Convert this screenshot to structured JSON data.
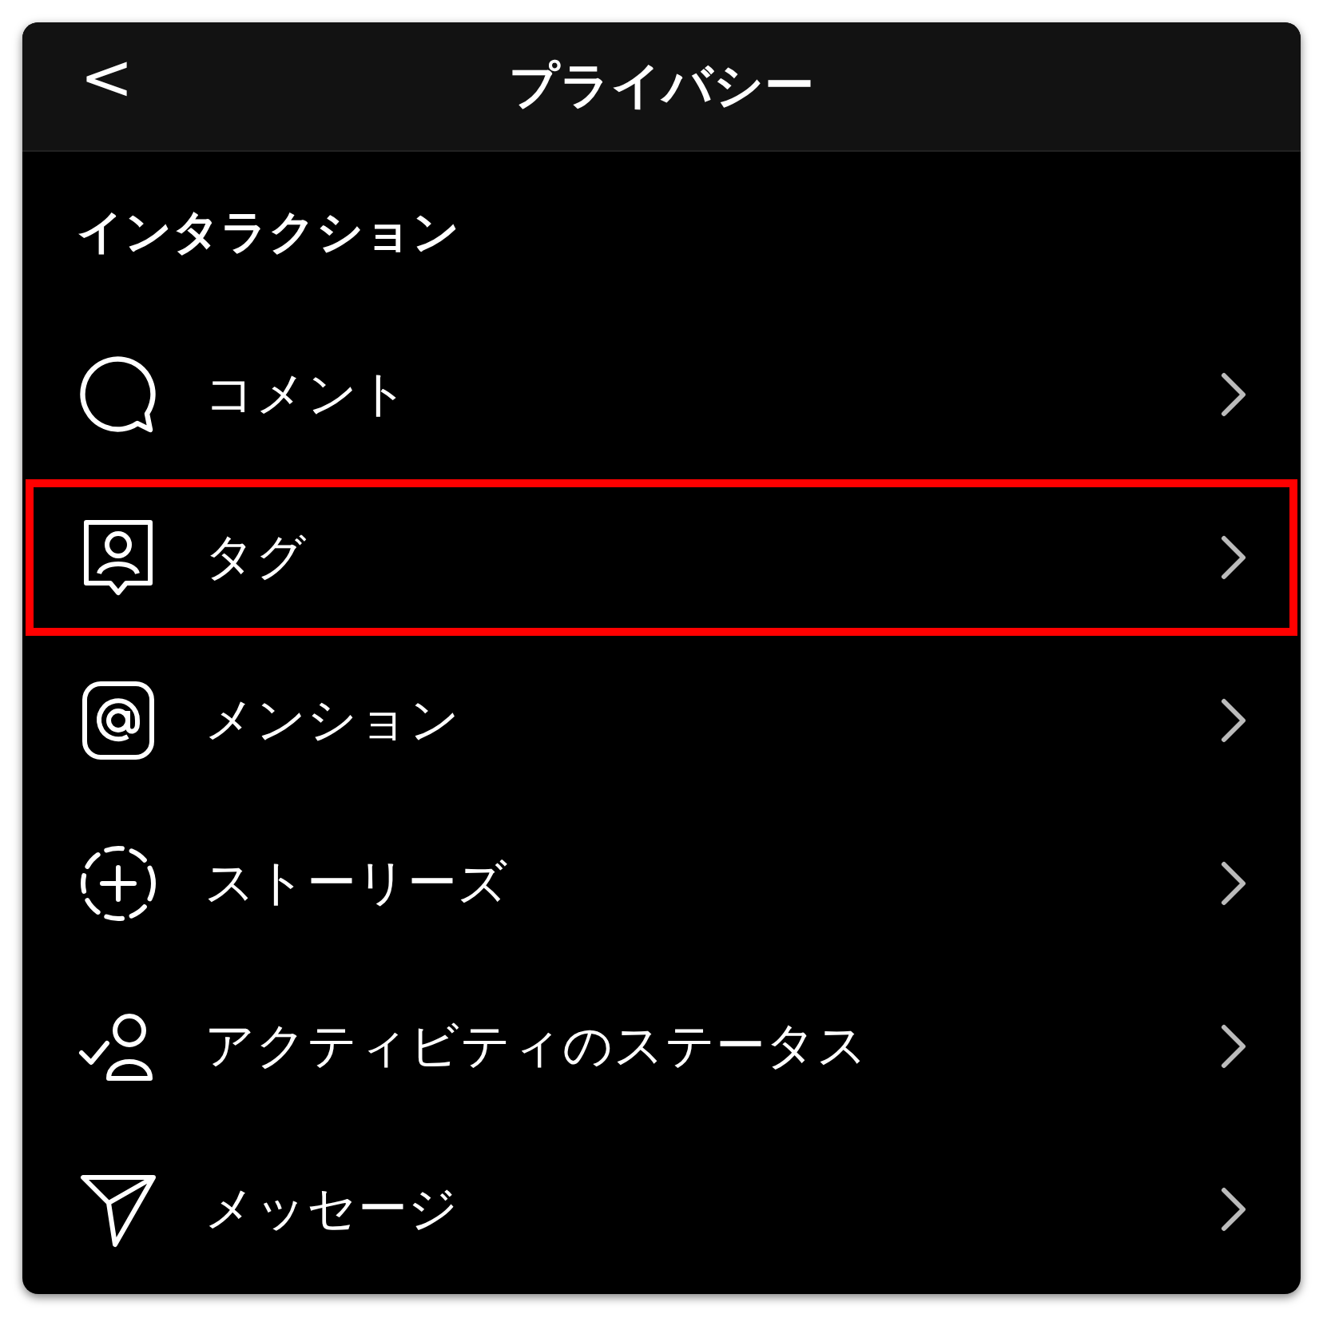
{
  "header": {
    "back": "<",
    "title": "プライバシー"
  },
  "section": {
    "title": "インタラクション"
  },
  "items": [
    {
      "label": "コメント",
      "highlighted": false
    },
    {
      "label": "タグ",
      "highlighted": true
    },
    {
      "label": "メンション",
      "highlighted": false
    },
    {
      "label": "ストーリーズ",
      "highlighted": false
    },
    {
      "label": "アクティビティのステータス",
      "highlighted": false
    },
    {
      "label": "メッセージ",
      "highlighted": false
    }
  ]
}
